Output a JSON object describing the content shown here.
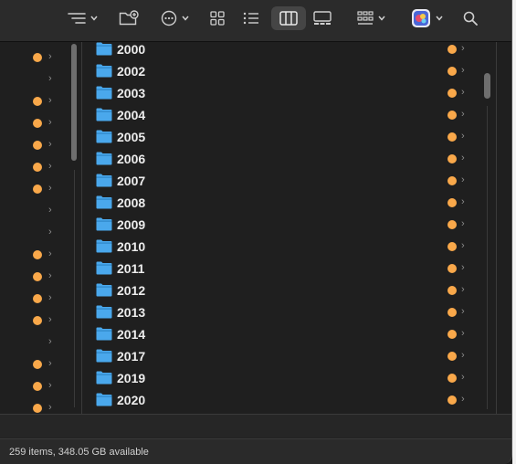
{
  "toolbar": {
    "items": [
      "group-by-icon",
      "new-folder-icon",
      "more-actions-icon",
      "icon-view-icon",
      "list-view-icon",
      "column-view-icon",
      "gallery-view-icon",
      "group-icon",
      "app-icon",
      "search-icon"
    ],
    "active_view": "column-view-icon"
  },
  "colors": {
    "tag_orange": "#f9a84a",
    "folder_blue": "#4aa8ec"
  },
  "folders": [
    {
      "name": "2000"
    },
    {
      "name": "2002"
    },
    {
      "name": "2003"
    },
    {
      "name": "2004"
    },
    {
      "name": "2005"
    },
    {
      "name": "2006"
    },
    {
      "name": "2007"
    },
    {
      "name": "2008"
    },
    {
      "name": "2009"
    },
    {
      "name": "2010"
    },
    {
      "name": "2011"
    },
    {
      "name": "2012"
    },
    {
      "name": "2013"
    },
    {
      "name": "2014"
    },
    {
      "name": "2017"
    },
    {
      "name": "2019"
    },
    {
      "name": "2020"
    }
  ],
  "status": {
    "text": "259 items, 348.05 GB available"
  }
}
